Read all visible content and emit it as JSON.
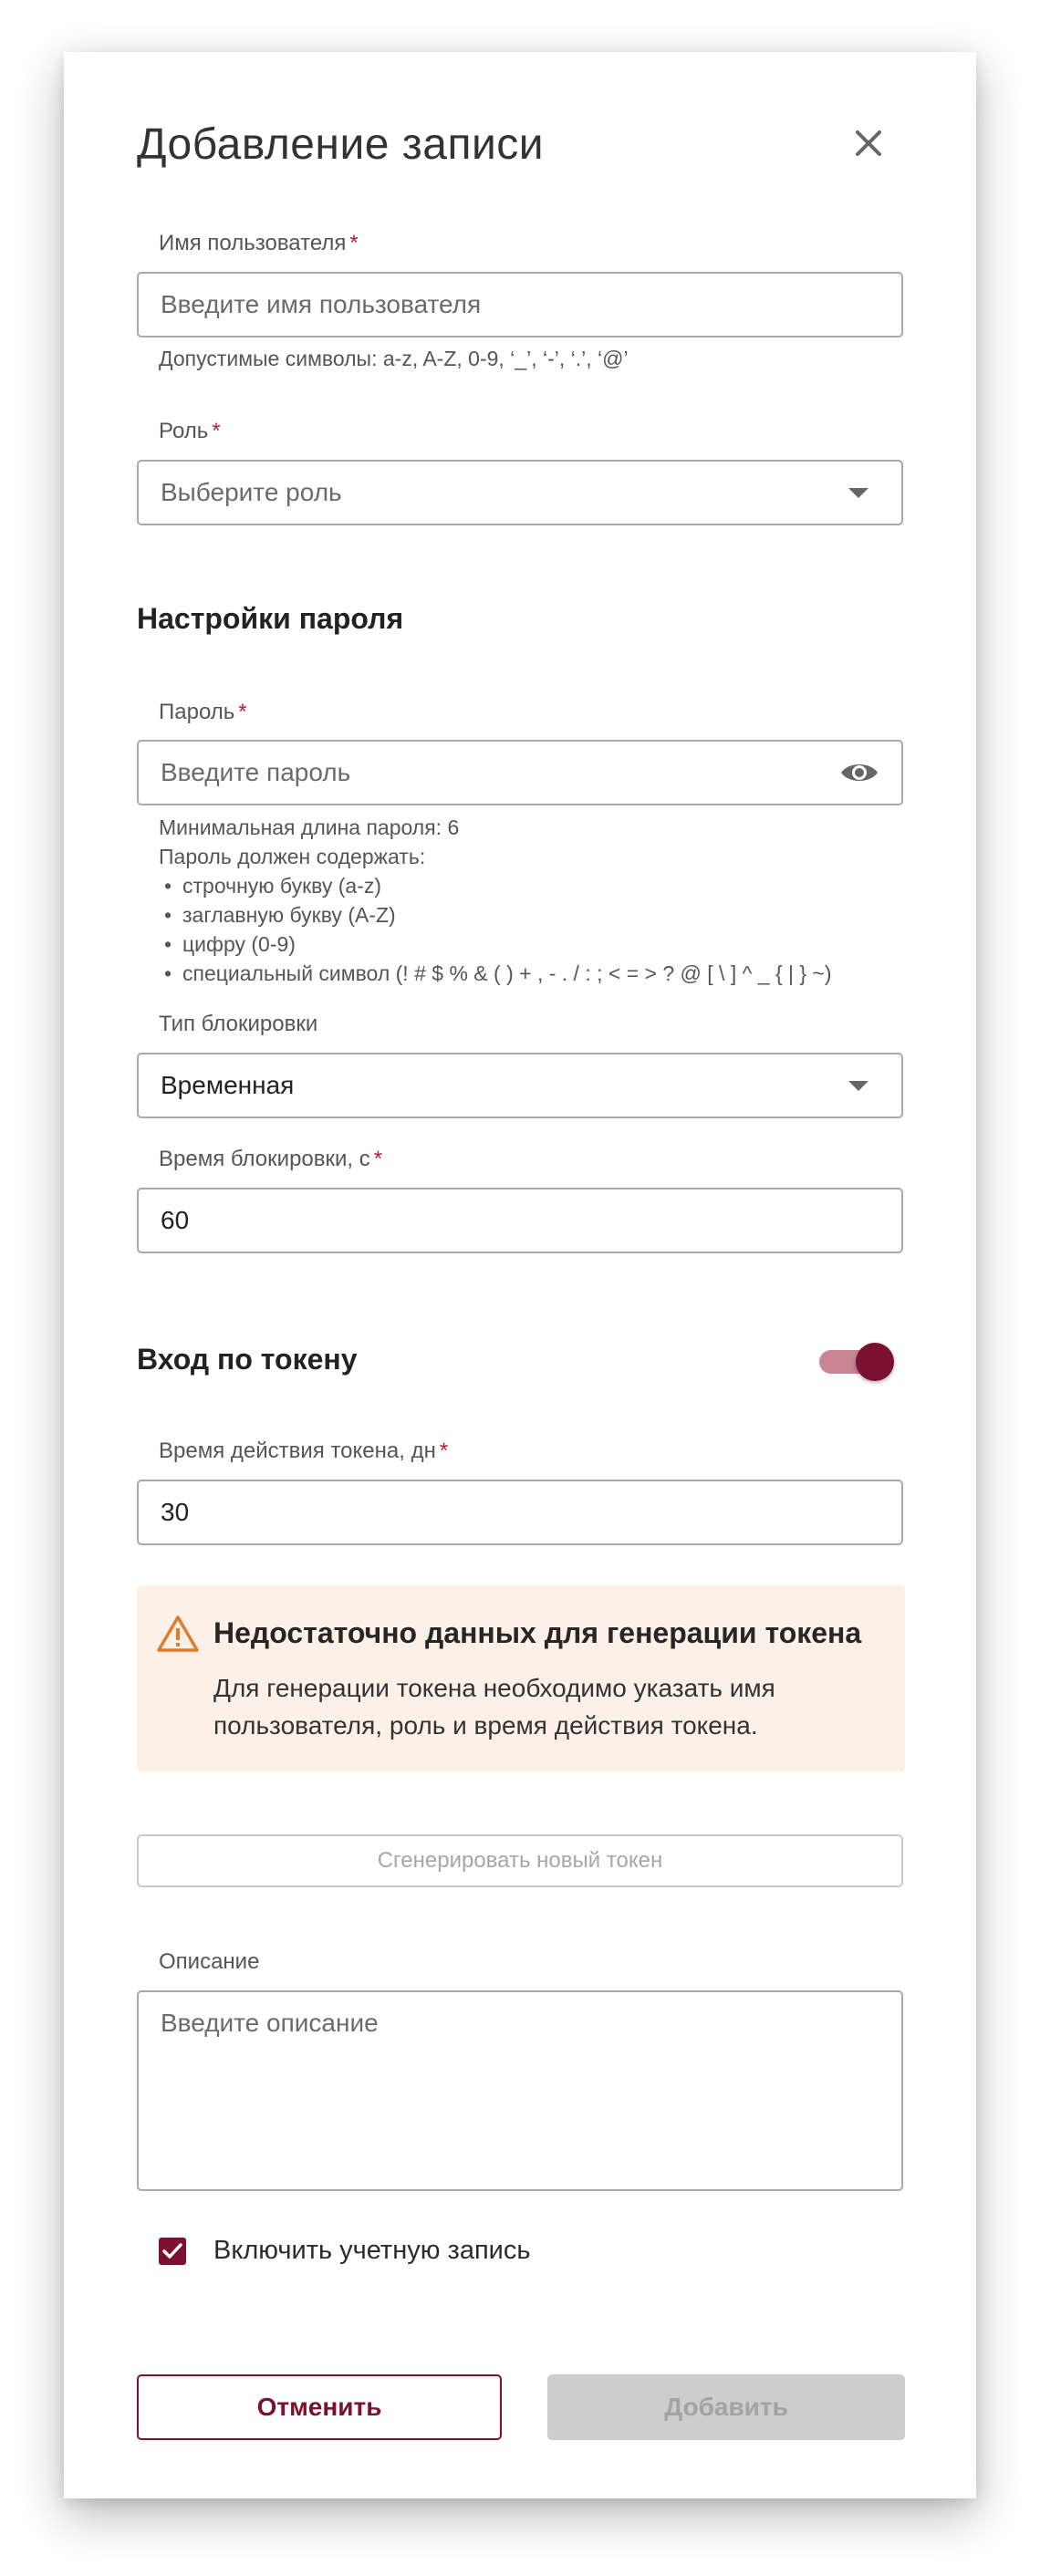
{
  "dialog": {
    "title": "Добавление записи",
    "close_icon": "close-icon"
  },
  "username": {
    "label": "Имя пользователя",
    "required_mark": "*",
    "placeholder": "Введите имя пользователя",
    "hint": "Допустимые символы: a-z, A-Z, 0-9, ‘_’, ‘-’, ‘.’, ‘@’"
  },
  "role": {
    "label": "Роль",
    "required_mark": "*",
    "placeholder": "Выберите роль"
  },
  "password_section": {
    "title": "Настройки пароля"
  },
  "password": {
    "label": "Пароль",
    "required_mark": "*",
    "placeholder": "Введите пароль",
    "visibility_icon": "eye-icon",
    "hint_min_length": "Минимальная длина пароля: 6",
    "hint_must_contain": "Пароль должен содержать:",
    "requirements": [
      "строчную букву (a-z)",
      "заглавную букву (A-Z)",
      "цифру (0-9)",
      "специальный символ (! # $ % & ( ) + , - . / : ; < = > ? @ [ \\ ] ^ _ { | } ~)"
    ]
  },
  "lock_type": {
    "label": "Тип блокировки",
    "value": "Временная"
  },
  "lock_time": {
    "label": "Время блокировки, с",
    "required_mark": "*",
    "value": "60"
  },
  "token_login": {
    "title": "Вход по токену",
    "enabled": true
  },
  "token_ttl": {
    "label": "Время действия токена, дн",
    "required_mark": "*",
    "value": "30"
  },
  "alert": {
    "icon": "warning-icon",
    "title": "Недостаточно данных для генерации токена",
    "text": "Для генерации токена необходимо указать имя пользователя, роль и время действия токена."
  },
  "generate_button": {
    "label": "Сгенерировать новый токен"
  },
  "description": {
    "label": "Описание",
    "placeholder": "Введите описание"
  },
  "enable_account": {
    "label": "Включить учетную запись",
    "checked": true
  },
  "actions": {
    "cancel_label": "Отменить",
    "add_label": "Добавить"
  },
  "colors": {
    "accent": "#7b1030",
    "required": "#b3202f",
    "alert_bg": "#fdf0e7",
    "alert_icon": "#e07b2c",
    "disabled_bg": "#cdcdcd"
  }
}
